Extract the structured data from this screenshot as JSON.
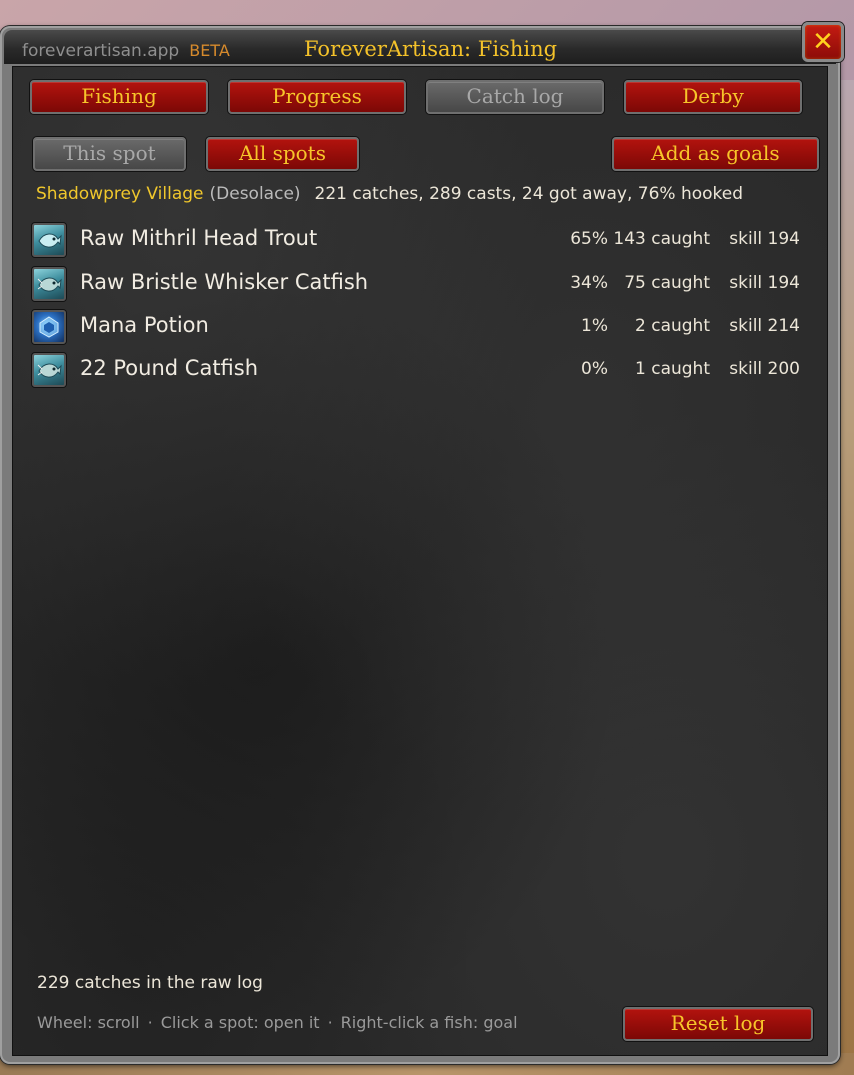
{
  "window": {
    "site": "foreverartisan.app",
    "badge": "BETA",
    "title": "ForeverArtisan: Fishing",
    "close_glyph": "✕"
  },
  "tabs": [
    {
      "label": "Fishing",
      "active": true
    },
    {
      "label": "Progress",
      "active": true
    },
    {
      "label": "Catch log",
      "active": false
    },
    {
      "label": "Derby",
      "active": true
    }
  ],
  "filters": {
    "this_spot": "This spot",
    "all_spots": "All spots",
    "add_goals": "Add as goals"
  },
  "spot": {
    "name": "Shadowprey Village",
    "zone": "(Desolace)",
    "stats": "221 catches, 289 casts, 24 got away, 76% hooked"
  },
  "catches": [
    {
      "icon": "fish-icon",
      "name": "Raw Mithril Head Trout",
      "pct": "65%",
      "caught": "143 caught",
      "skill": "skill 194"
    },
    {
      "icon": "fish-icon",
      "name": "Raw Bristle Whisker Catfish",
      "pct": "34%",
      "caught": "75 caught",
      "skill": "skill 194"
    },
    {
      "icon": "potion-icon",
      "name": "Mana Potion",
      "pct": "1%",
      "caught": "2 caught",
      "skill": "skill 214"
    },
    {
      "icon": "fish-icon",
      "name": "22 Pound Catfish",
      "pct": "0%",
      "caught": "1 caught",
      "skill": "skill 200"
    }
  ],
  "footer": {
    "raw_log": "229 catches in the raw log",
    "hint_scroll": "Wheel: scroll",
    "hint_spot": "Click a spot: open it",
    "hint_goal": "Right-click a fish: goal",
    "hint_sep": "·",
    "reset": "Reset log"
  },
  "colors": {
    "accent_gold": "#f4c22a",
    "button_red": "#b3130e",
    "button_gray": "#5a5a5a",
    "beta_orange": "#d68a2c"
  }
}
